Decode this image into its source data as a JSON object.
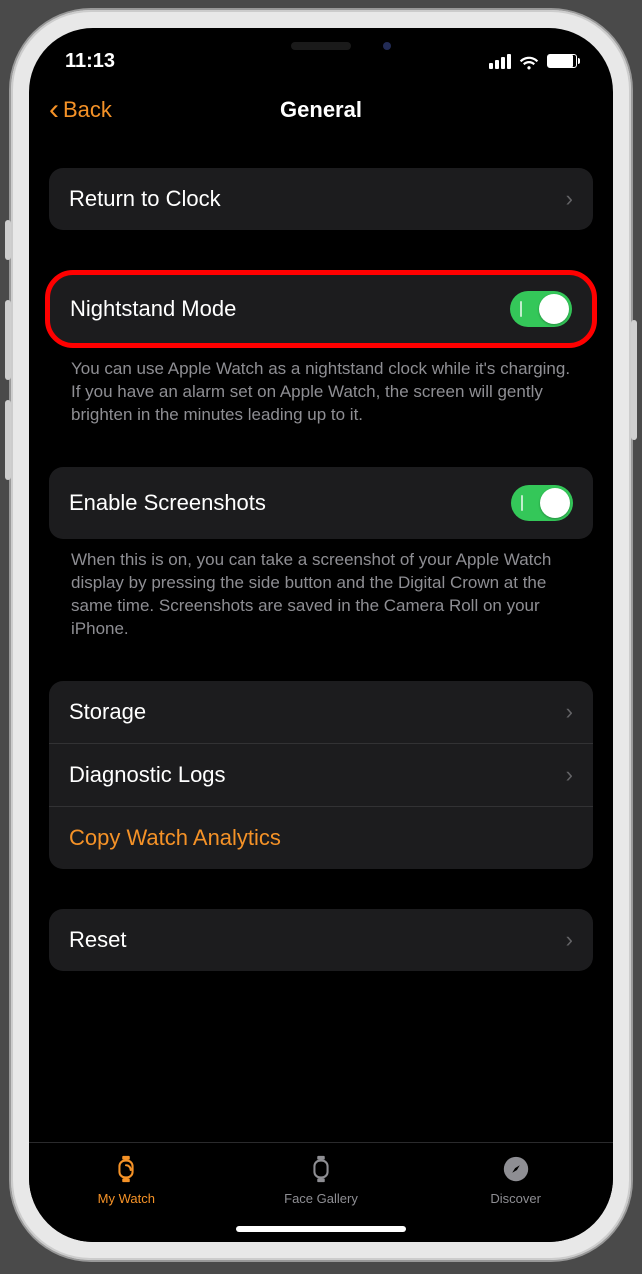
{
  "statusbar": {
    "time": "11:13"
  },
  "nav": {
    "back": "Back",
    "title": "General"
  },
  "rows": {
    "return_to_clock": "Return to Clock",
    "nightstand": "Nightstand Mode",
    "nightstand_note": "You can use Apple Watch as a nightstand clock while it's charging. If you have an alarm set on Apple Watch, the screen will gently brighten in the minutes leading up to it.",
    "screenshots": "Enable Screenshots",
    "screenshots_note": "When this is on, you can take a screenshot of your Apple Watch display by pressing the side button and the Digital Crown at the same time. Screenshots are saved in the Camera Roll on your iPhone.",
    "storage": "Storage",
    "diag": "Diagnostic Logs",
    "copy_analytics": "Copy Watch Analytics",
    "reset": "Reset"
  },
  "tabs": {
    "mywatch": "My Watch",
    "facegallery": "Face Gallery",
    "discover": "Discover"
  }
}
